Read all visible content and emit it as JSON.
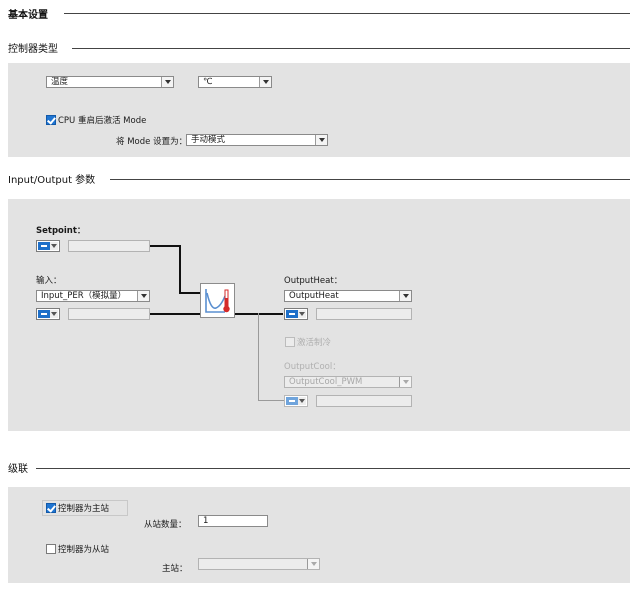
{
  "sections": {
    "basic_settings": "基本设置",
    "controller_type": "控制器类型",
    "io_params": "Input/Output 参数",
    "cascade": "级联"
  },
  "controller_type": {
    "quantity_value": "温度",
    "unit_value": "℃",
    "activate_mode_label": "CPU 重启后激活 Mode",
    "activate_mode_checked": true,
    "set_mode_label": "将 Mode 设置为：",
    "mode_value": "手动模式"
  },
  "io": {
    "setpoint_label": "Setpoint：",
    "input_label": "输入：",
    "input_value": "Input_PER（模拟量）",
    "output_heat_label": "OutputHeat：",
    "output_heat_value": "OutputHeat",
    "activate_cooling_label": "激活制冷",
    "activate_cooling_checked": false,
    "output_cool_label": "OutputCool：",
    "output_cool_value": "OutputCool_PWM"
  },
  "cascade": {
    "master_label": "控制器为主站",
    "master_checked": true,
    "slave_count_label": "从站数量：",
    "slave_count_value": "1",
    "slave_label": "控制器为从站",
    "slave_checked": false,
    "master_select_label": "主站：",
    "master_select_value": ""
  },
  "colors": {
    "panel": "#e3e3e3",
    "accent": "#1f75d2",
    "thermometer": "#d42a2a"
  },
  "icons": [
    "checkbox-checked-icon",
    "dropdown-arrow-icon",
    "connector-plug-icon",
    "pid-controller-icon"
  ]
}
